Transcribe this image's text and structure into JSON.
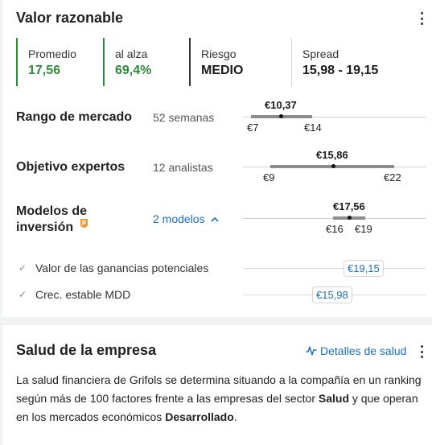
{
  "fair_value": {
    "title": "Valor razonable",
    "metrics": [
      {
        "label": "Promedio",
        "value": "17,56"
      },
      {
        "label": "al alza",
        "value": "69,4%"
      },
      {
        "label": "Riesgo",
        "value": "MEDIO"
      },
      {
        "label": "Spread",
        "value": "15,98 - 19,15"
      }
    ],
    "market_range": {
      "title": "Rango de mercado",
      "sub": "52 semanas",
      "current": "€10,37",
      "low": "€7",
      "high": "€14"
    },
    "expert_target": {
      "title": "Objetivo expertos",
      "sub": "12 analistas",
      "current": "€15,86",
      "low": "€9",
      "high": "€22"
    },
    "investment_models": {
      "title_line1": "Modelos de",
      "title_line2": "inversión",
      "link": "2 modelos",
      "current": "€17,56",
      "low": "€16",
      "high": "€19"
    },
    "models": [
      {
        "label": "Valor de las ganancias potenciales",
        "value": "€19,15"
      },
      {
        "label": "Crec. estable MDD",
        "value": "€15,98"
      }
    ]
  },
  "health": {
    "title": "Salud de la empresa",
    "details_link": "Detalles de salud",
    "desc_part1": "La salud financiera de Grifols se determina situando a la compañía en un ranking según más de 100 factores frente a las empresas del sector ",
    "desc_bold1": "Salud",
    "desc_part2": " y que operan en los mercados económicos ",
    "desc_bold2": "Desarrollado",
    "desc_part3": "."
  },
  "colors": {
    "positive": "#2e8b3a",
    "link": "#1a6fc0",
    "premium": "#f29a38"
  }
}
